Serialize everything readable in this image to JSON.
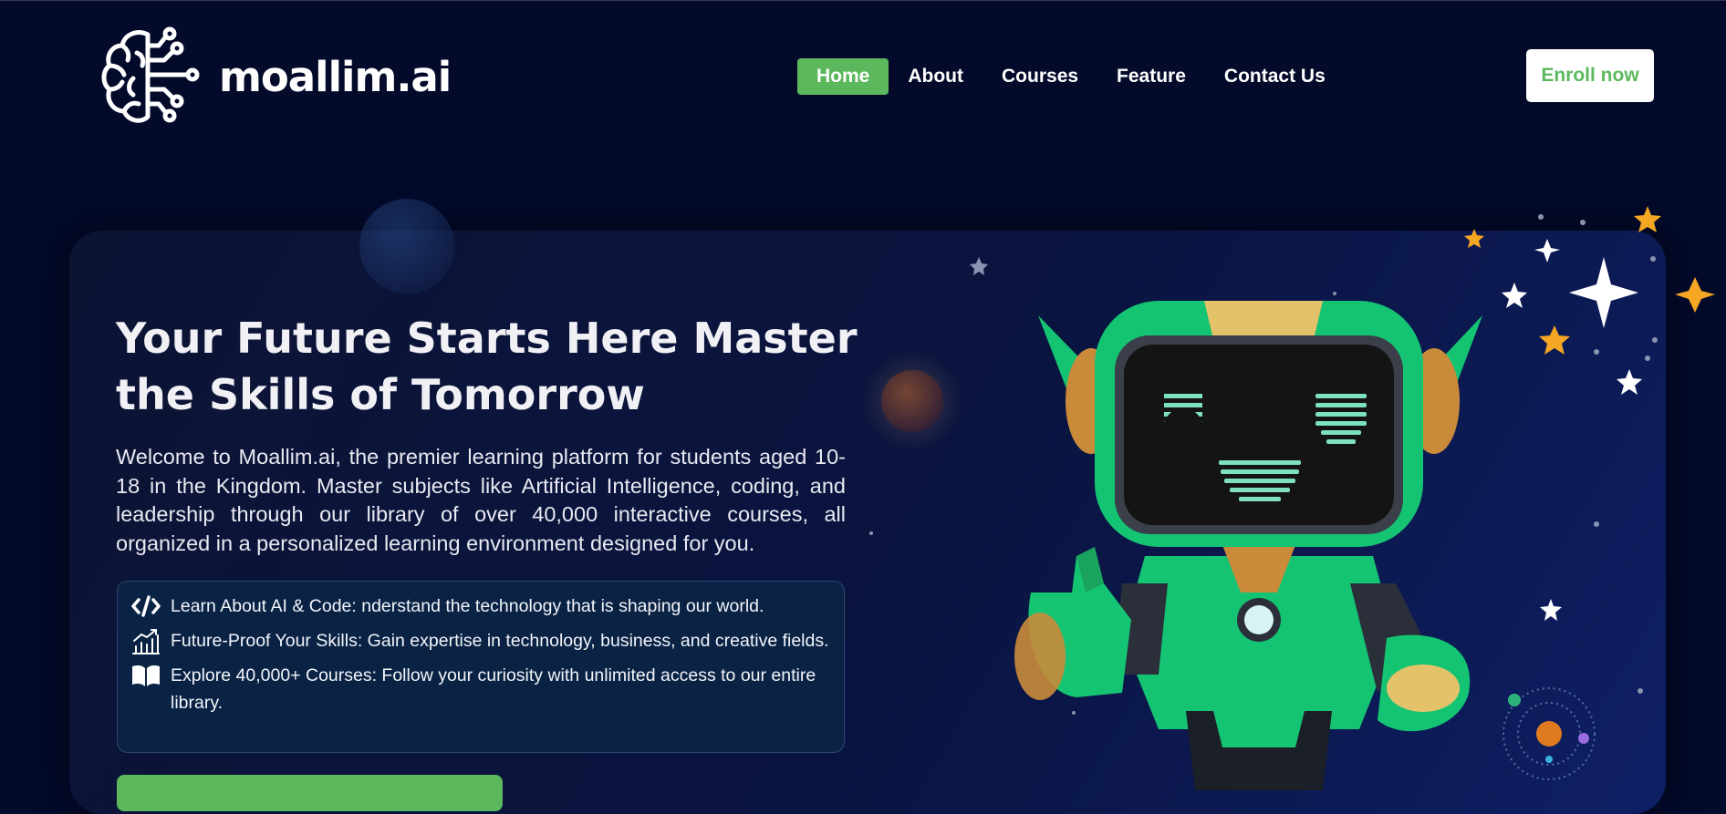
{
  "brand": {
    "name": "moallim.ai"
  },
  "nav": {
    "items": [
      {
        "label": "Home",
        "active": true
      },
      {
        "label": "About",
        "active": false
      },
      {
        "label": "Courses",
        "active": false
      },
      {
        "label": "Feature",
        "active": false
      },
      {
        "label": "Contact Us",
        "active": false
      }
    ]
  },
  "header": {
    "enroll_label": "Enroll now"
  },
  "hero": {
    "title": "Your Future Starts Here Master the Skills of Tomorrow",
    "description": "Welcome to Moallim.ai, the premier learning platform for students aged 10-18 in the Kingdom. Master subjects like Artificial Intelligence, coding, and leadership through our library of over 40,000 interactive courses, all organized in a personalized learning environment designed for you.",
    "features": [
      {
        "icon": "code-icon",
        "text": "Learn About AI & Code: nderstand the technology that is shaping our world."
      },
      {
        "icon": "growth-chart-icon",
        "text": "Future-Proof Your Skills: Gain expertise in technology, business, and creative fields."
      },
      {
        "icon": "open-book-icon",
        "text": "Explore 40,000+ Courses: Follow your curiosity with unlimited access to our entire library."
      }
    ]
  },
  "colors": {
    "background": "#030a2a",
    "accent_green": "#5cb85c",
    "robot_green": "#14c473",
    "star_gold": "#f5a623"
  }
}
